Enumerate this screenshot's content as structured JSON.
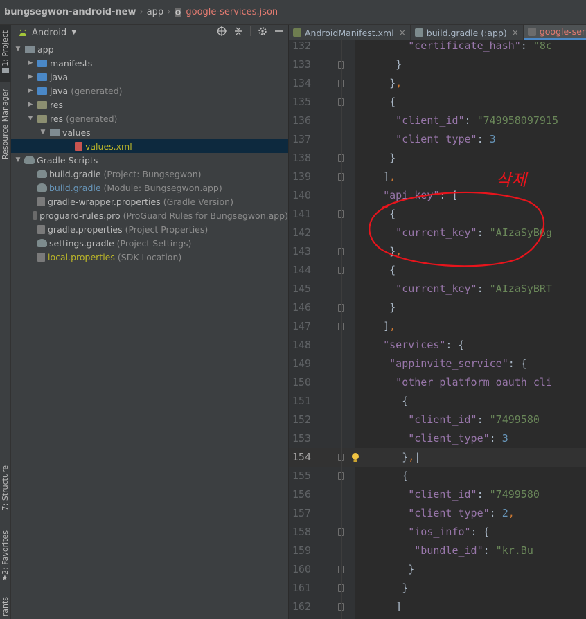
{
  "breadcrumb": {
    "project": "bungsegwon-android-new",
    "module": "app",
    "file": "google-services.json"
  },
  "tool_strip": {
    "project": "1: Project",
    "resource_manager": "Resource Manager",
    "structure": "7: Structure",
    "favorites": "2: Favorites",
    "variants": "rants"
  },
  "project_panel": {
    "view_label": "Android",
    "icons": [
      "target-icon",
      "collapse-icon",
      "gear-icon",
      "minimize-icon"
    ],
    "tree": [
      {
        "label": "app",
        "hint": "",
        "arrow": "▼",
        "icon": "module-folder",
        "indent": 0,
        "name_color": "#bbbbbb"
      },
      {
        "label": "manifests",
        "hint": "",
        "arrow": "▶",
        "icon": "folder-blue",
        "indent": 1,
        "name_color": "#bbbbbb"
      },
      {
        "label": "java",
        "hint": "",
        "arrow": "▶",
        "icon": "folder-blue",
        "indent": 1,
        "name_color": "#bbbbbb"
      },
      {
        "label": "java",
        "hint": "(generated)",
        "arrow": "▶",
        "icon": "folder-gen",
        "indent": 1,
        "name_color": "#bbbbbb"
      },
      {
        "label": "res",
        "hint": "",
        "arrow": "▶",
        "icon": "folder-res",
        "indent": 1,
        "name_color": "#bbbbbb"
      },
      {
        "label": "res",
        "hint": "(generated)",
        "arrow": "▼",
        "icon": "folder-res",
        "indent": 1,
        "name_color": "#bbbbbb"
      },
      {
        "label": "values",
        "hint": "",
        "arrow": "▼",
        "icon": "folder-gray",
        "indent": 2,
        "name_color": "#bbbbbb"
      },
      {
        "label": "values.xml",
        "hint": "",
        "arrow": "",
        "icon": "xml-file",
        "indent": 4,
        "name_color": "#bbb529",
        "selected": true
      },
      {
        "label": "Gradle Scripts",
        "hint": "",
        "arrow": "▼",
        "icon": "gradle",
        "indent": 0,
        "name_color": "#bbbbbb"
      },
      {
        "label": "build.gradle",
        "hint": "(Project: Bungsegwon)",
        "arrow": "",
        "icon": "gradle",
        "indent": 1,
        "name_color": "#bbbbbb"
      },
      {
        "label": "build.gradle",
        "hint": "(Module: Bungsegwon.app)",
        "arrow": "",
        "icon": "gradle",
        "indent": 1,
        "name_color": "#6897bb"
      },
      {
        "label": "gradle-wrapper.properties",
        "hint": "(Gradle Version)",
        "arrow": "",
        "icon": "properties",
        "indent": 1,
        "name_color": "#bbbbbb"
      },
      {
        "label": "proguard-rules.pro",
        "hint": "(ProGuard Rules for Bungsegwon.app)",
        "arrow": "",
        "icon": "text-file",
        "indent": 1,
        "name_color": "#bbbbbb"
      },
      {
        "label": "gradle.properties",
        "hint": "(Project Properties)",
        "arrow": "",
        "icon": "properties",
        "indent": 1,
        "name_color": "#bbbbbb"
      },
      {
        "label": "settings.gradle",
        "hint": "(Project Settings)",
        "arrow": "",
        "icon": "gradle",
        "indent": 1,
        "name_color": "#bbbbbb"
      },
      {
        "label": "local.properties",
        "hint": "(SDK Location)",
        "arrow": "",
        "icon": "properties",
        "indent": 1,
        "name_color": "#bbb529"
      }
    ]
  },
  "tabs": [
    {
      "label": "AndroidManifest.xml",
      "icon": "manifest-icon",
      "active": false,
      "close": "×"
    },
    {
      "label": "build.gradle (:app)",
      "icon": "gradle-icon",
      "active": false,
      "close": "×"
    },
    {
      "label": "google-services.json",
      "icon": "json-icon",
      "active": true,
      "close": ""
    }
  ],
  "code_lines": [
    {
      "num": "132",
      "indent": 16,
      "tokens": [
        [
          "k",
          "\"certificate_hash\""
        ],
        [
          "t",
          ": "
        ],
        [
          "s",
          "\"8c"
        ]
      ]
    },
    {
      "num": "133",
      "indent": 12,
      "tokens": [
        [
          "t",
          "}"
        ]
      ]
    },
    {
      "num": "134",
      "indent": 10,
      "tokens": [
        [
          "t",
          "}"
        ],
        [
          "p",
          ","
        ]
      ]
    },
    {
      "num": "135",
      "indent": 10,
      "tokens": [
        [
          "t",
          "{"
        ]
      ]
    },
    {
      "num": "136",
      "indent": 12,
      "tokens": [
        [
          "k",
          "\"client_id\""
        ],
        [
          "t",
          ": "
        ],
        [
          "s",
          "\"749958097915"
        ]
      ]
    },
    {
      "num": "137",
      "indent": 12,
      "tokens": [
        [
          "k",
          "\"client_type\""
        ],
        [
          "t",
          ": "
        ],
        [
          "n",
          "3"
        ]
      ]
    },
    {
      "num": "138",
      "indent": 10,
      "tokens": [
        [
          "t",
          "}"
        ]
      ]
    },
    {
      "num": "139",
      "indent": 8,
      "tokens": [
        [
          "t",
          "]"
        ],
        [
          "p",
          ","
        ]
      ]
    },
    {
      "num": "140",
      "indent": 8,
      "tokens": [
        [
          "k",
          "\"api_key\""
        ],
        [
          "t",
          ": ["
        ]
      ]
    },
    {
      "num": "141",
      "indent": 10,
      "tokens": [
        [
          "t",
          "{"
        ]
      ]
    },
    {
      "num": "142",
      "indent": 12,
      "tokens": [
        [
          "k",
          "\"current_key\""
        ],
        [
          "t",
          ": "
        ],
        [
          "s",
          "\"AIzaSyB6g"
        ]
      ]
    },
    {
      "num": "143",
      "indent": 10,
      "tokens": [
        [
          "t",
          "}"
        ],
        [
          "p",
          ","
        ]
      ]
    },
    {
      "num": "144",
      "indent": 10,
      "tokens": [
        [
          "t",
          "{"
        ]
      ]
    },
    {
      "num": "145",
      "indent": 12,
      "tokens": [
        [
          "k",
          "\"current_key\""
        ],
        [
          "t",
          ": "
        ],
        [
          "s",
          "\"AIzaSyBRT"
        ]
      ]
    },
    {
      "num": "146",
      "indent": 10,
      "tokens": [
        [
          "t",
          "}"
        ]
      ]
    },
    {
      "num": "147",
      "indent": 8,
      "tokens": [
        [
          "t",
          "]"
        ],
        [
          "p",
          ","
        ]
      ]
    },
    {
      "num": "148",
      "indent": 8,
      "tokens": [
        [
          "k",
          "\"services\""
        ],
        [
          "t",
          ": {"
        ]
      ]
    },
    {
      "num": "149",
      "indent": 10,
      "tokens": [
        [
          "k",
          "\"appinvite_service\""
        ],
        [
          "t",
          ": {"
        ]
      ]
    },
    {
      "num": "150",
      "indent": 12,
      "tokens": [
        [
          "k",
          "\"other_platform_oauth_cli"
        ]
      ]
    },
    {
      "num": "151",
      "indent": 14,
      "tokens": [
        [
          "t",
          "{"
        ]
      ]
    },
    {
      "num": "152",
      "indent": 16,
      "tokens": [
        [
          "k",
          "\"client_id\""
        ],
        [
          "t",
          ": "
        ],
        [
          "s",
          "\"7499580"
        ]
      ]
    },
    {
      "num": "153",
      "indent": 16,
      "tokens": [
        [
          "k",
          "\"client_type\""
        ],
        [
          "t",
          ": "
        ],
        [
          "n",
          "3"
        ]
      ]
    },
    {
      "num": "154",
      "indent": 14,
      "tokens": [
        [
          "t",
          "}"
        ],
        [
          "p",
          ","
        ],
        [
          "t",
          "|"
        ]
      ],
      "current": true
    },
    {
      "num": "155",
      "indent": 14,
      "tokens": [
        [
          "t",
          "{"
        ]
      ]
    },
    {
      "num": "156",
      "indent": 16,
      "tokens": [
        [
          "k",
          "\"client_id\""
        ],
        [
          "t",
          ": "
        ],
        [
          "s",
          "\"7499580"
        ]
      ]
    },
    {
      "num": "157",
      "indent": 16,
      "tokens": [
        [
          "k",
          "\"client_type\""
        ],
        [
          "t",
          ": "
        ],
        [
          "n",
          "2"
        ],
        [
          "p",
          ","
        ]
      ]
    },
    {
      "num": "158",
      "indent": 16,
      "tokens": [
        [
          "k",
          "\"ios_info\""
        ],
        [
          "t",
          ": {"
        ]
      ]
    },
    {
      "num": "159",
      "indent": 18,
      "tokens": [
        [
          "k",
          "\"bundle_id\""
        ],
        [
          "t",
          ": "
        ],
        [
          "s",
          "\"kr.Bu"
        ]
      ]
    },
    {
      "num": "160",
      "indent": 16,
      "tokens": [
        [
          "t",
          "}"
        ]
      ]
    },
    {
      "num": "161",
      "indent": 14,
      "tokens": [
        [
          "t",
          "}"
        ]
      ]
    },
    {
      "num": "162",
      "indent": 12,
      "tokens": [
        [
          "t",
          "]"
        ]
      ]
    }
  ],
  "annotation_text": "삭제",
  "colors": {
    "annotation": "#e8141c",
    "selection": "#0d293e",
    "active_tab_text": "#e37b71"
  }
}
